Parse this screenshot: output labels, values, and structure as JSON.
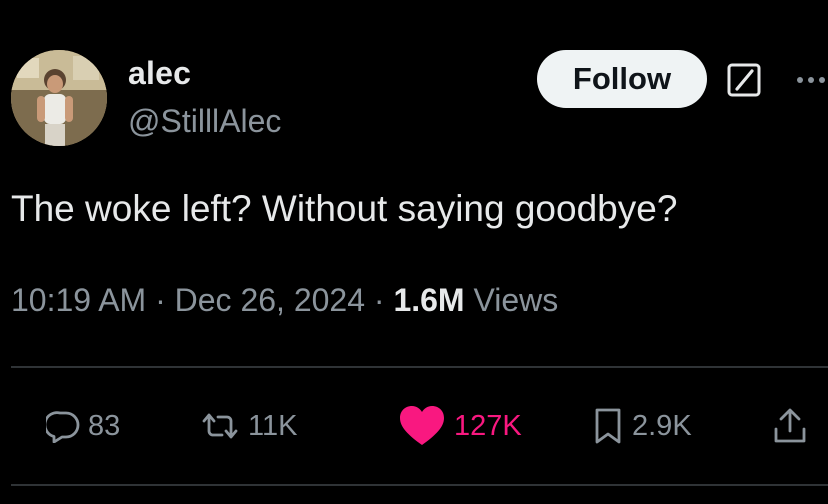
{
  "author": {
    "display_name": "alec",
    "handle": "@StilllAlec",
    "avatar_icon": "profile-photo"
  },
  "header": {
    "follow_label": "Follow",
    "grok_icon": "grok-icon",
    "more_icon": "more-options-icon"
  },
  "tweet": {
    "text": "The woke left? Without saying goodbye?"
  },
  "meta": {
    "time": "10:19 AM",
    "separator": "·",
    "date": "Dec 26, 2024",
    "views_count": "1.6M",
    "views_label": "Views"
  },
  "actions": {
    "replies": "83",
    "reposts": "11K",
    "likes": "127K",
    "bookmarks": "2.9K"
  },
  "colors": {
    "background": "#000000",
    "text_primary": "#e7e9ea",
    "text_secondary": "#8b949c",
    "like_active": "#f91880",
    "follow_button_bg": "#eff3f4"
  }
}
